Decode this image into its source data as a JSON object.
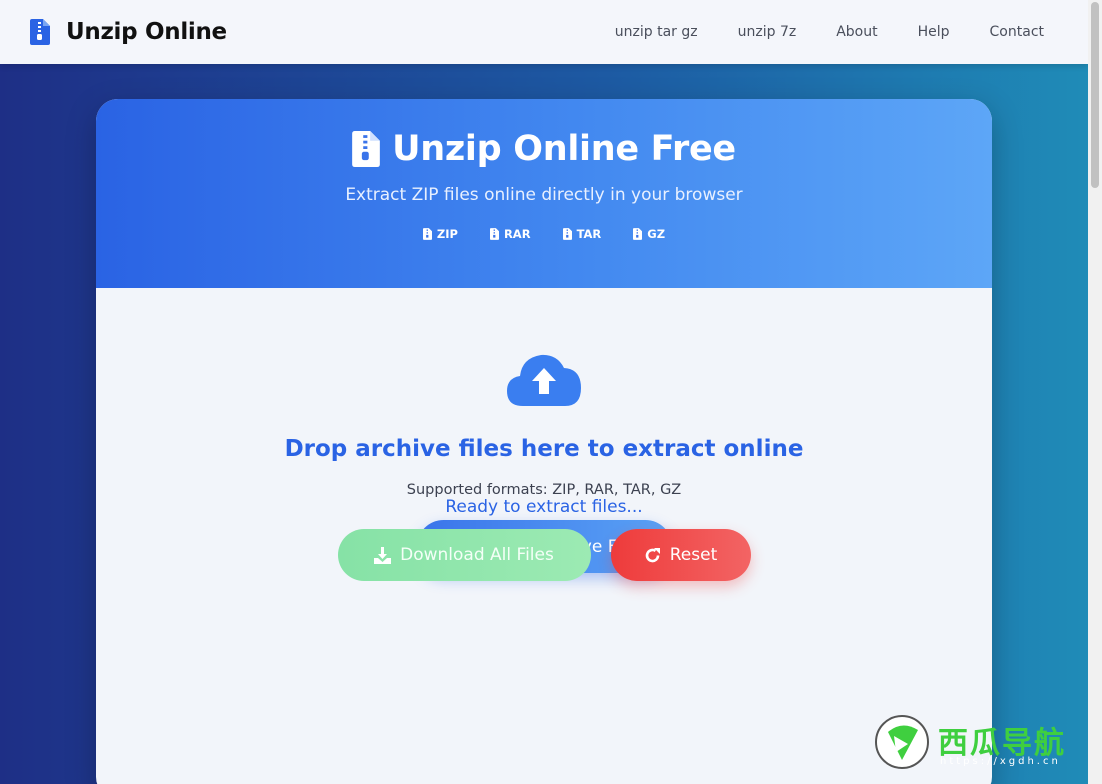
{
  "navbar": {
    "brand": "Unzip Online",
    "links": [
      {
        "label": "unzip tar gz"
      },
      {
        "label": "unzip 7z"
      },
      {
        "label": "About"
      },
      {
        "label": "Help"
      },
      {
        "label": "Contact"
      }
    ]
  },
  "hero": {
    "title": "Unzip Online Free",
    "subtitle": "Extract ZIP files online directly in your browser",
    "formats": [
      "ZIP",
      "RAR",
      "TAR",
      "GZ"
    ]
  },
  "drop_zone": {
    "icon": "cloud-upload-icon",
    "title": "Drop archive files here to extract online",
    "supported": "Supported formats: ZIP, RAR, TAR, GZ",
    "select_label": "Select Archive File"
  },
  "status": {
    "text": "Ready to extract files..."
  },
  "actions": {
    "download_label": "Download All Files",
    "reset_label": "Reset"
  },
  "watermark": {
    "text": "西瓜导航",
    "url": "https://xgdh.cn"
  },
  "colors": {
    "accent": "#2a63e4",
    "success": "#86e2a6",
    "danger": "#ee3b3b"
  }
}
